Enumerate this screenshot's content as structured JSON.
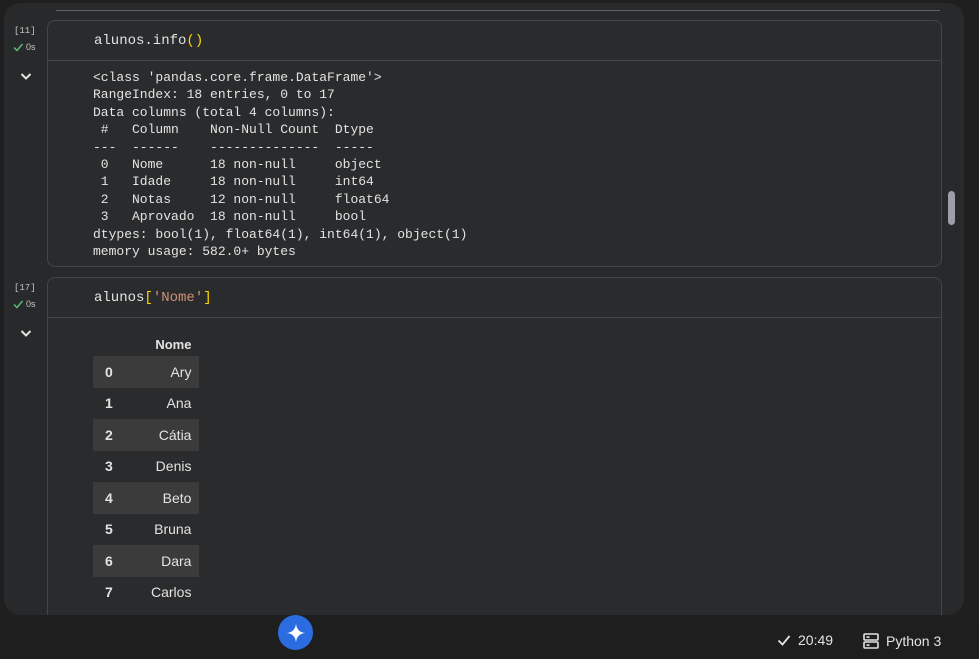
{
  "cells": [
    {
      "exec_count": "[11]",
      "status": "0s",
      "code_prefix": "alunos.info",
      "code_paren": "()",
      "output_lines": "<class 'pandas.core.frame.DataFrame'>\nRangeIndex: 18 entries, 0 to 17\nData columns (total 4 columns):\n #   Column    Non-Null Count  Dtype  \n---  ------    --------------  -----  \n 0   Nome      18 non-null     object \n 1   Idade     18 non-null     int64  \n 2   Notas     12 non-null     float64\n 3   Aprovado  18 non-null     bool   \ndtypes: bool(1), float64(1), int64(1), object(1)\nmemory usage: 582.0+ bytes"
    },
    {
      "exec_count": "[17]",
      "status": "0s",
      "code_prefix": "alunos",
      "code_bracket_open": "[",
      "code_string": "'Nome'",
      "code_bracket_close": "]",
      "table": {
        "column": "Nome",
        "rows": [
          {
            "index": "0",
            "value": "Ary"
          },
          {
            "index": "1",
            "value": "Ana"
          },
          {
            "index": "2",
            "value": "Cátia"
          },
          {
            "index": "3",
            "value": "Denis"
          },
          {
            "index": "4",
            "value": "Beto"
          },
          {
            "index": "5",
            "value": "Bruna"
          },
          {
            "index": "6",
            "value": "Dara"
          },
          {
            "index": "7",
            "value": "Carlos"
          }
        ]
      }
    }
  ],
  "statusbar": {
    "time": "20:49",
    "runtime": "Python 3"
  },
  "icons": {
    "check": "check-icon",
    "collapse": "chevron-down-icon",
    "gemini": "sparkle-icon",
    "runtime": "server-icon"
  },
  "colors": {
    "accent": "#2b6de0",
    "success": "#5bb974",
    "string": "#ce9178",
    "bracket": "#ffd700"
  }
}
